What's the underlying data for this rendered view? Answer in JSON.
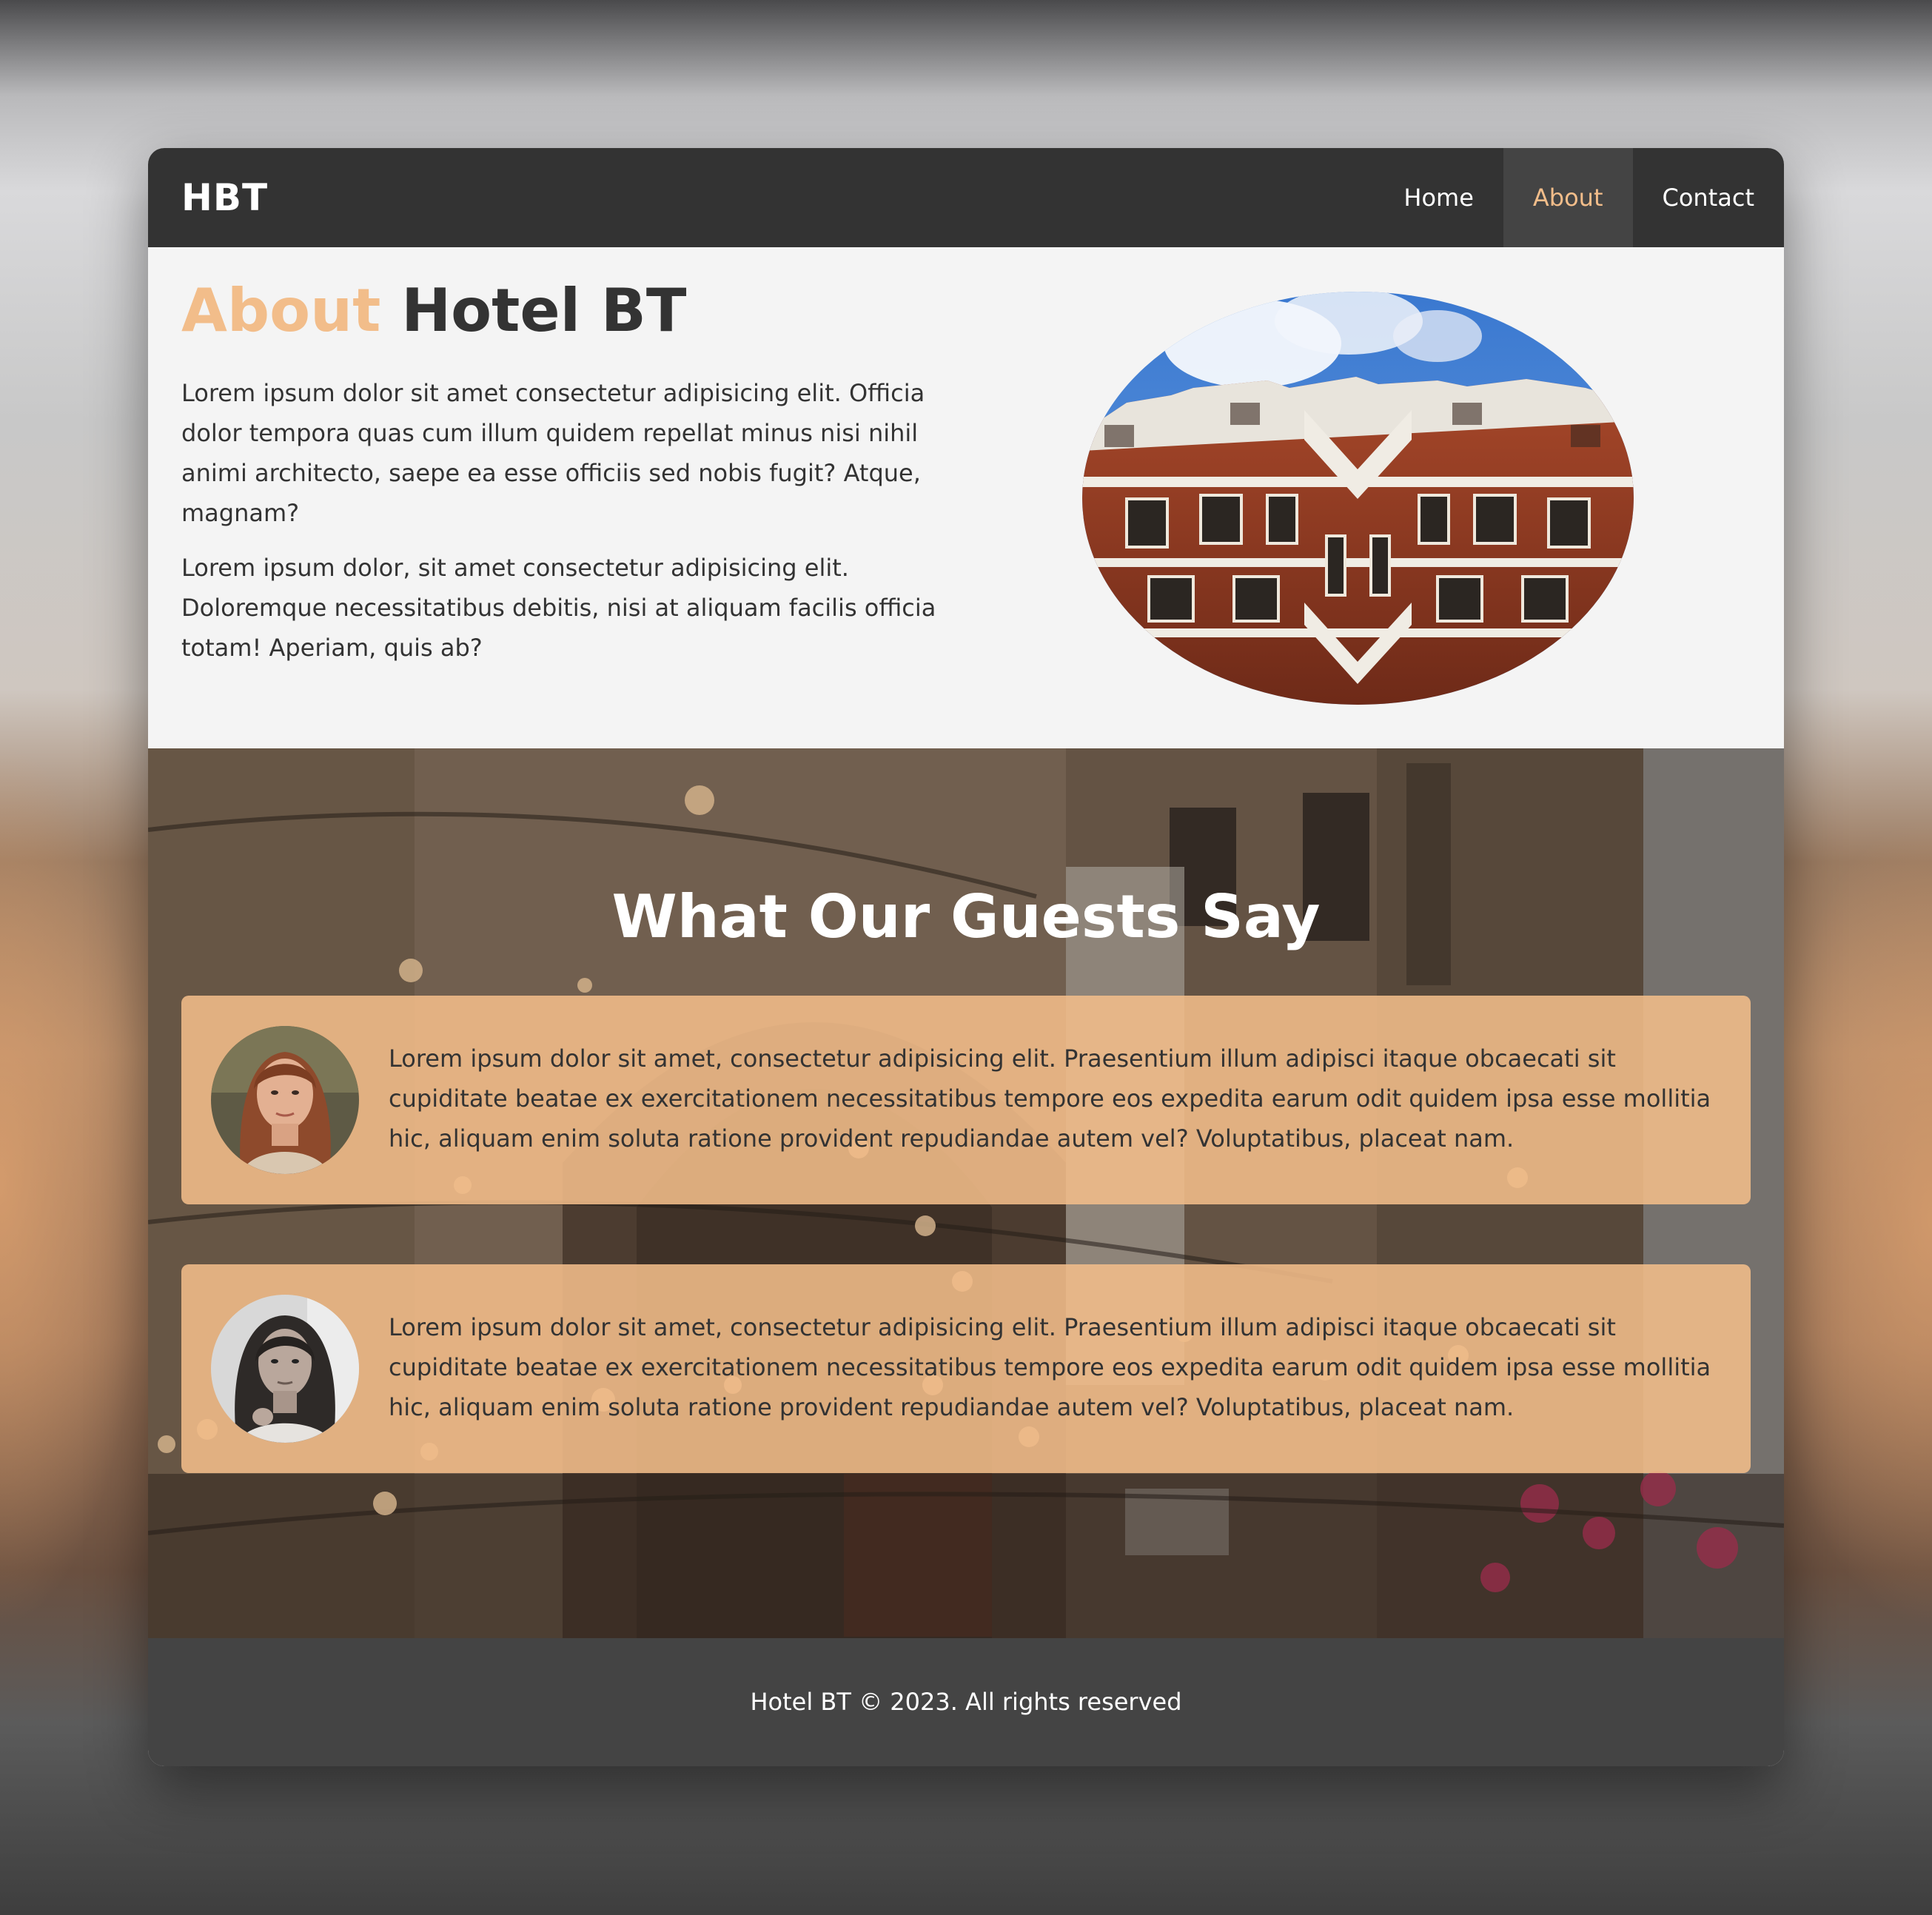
{
  "nav": {
    "logo": "HBT",
    "links": [
      {
        "label": "Home",
        "active": false
      },
      {
        "label": "About",
        "active": true
      },
      {
        "label": "Contact",
        "active": false
      }
    ]
  },
  "about": {
    "title_accent": "About",
    "title_rest": " Hotel BT",
    "paragraphs": [
      "Lorem ipsum dolor sit amet consectetur adipisicing elit. Officia dolor tempora quas cum illum quidem repellat minus nisi nihil animi architecto, saepe ea esse officiis sed nobis fugit? Atque, magnam?",
      "Lorem ipsum dolor, sit amet consectetur adipisicing elit. Doloremque necessitatibus debitis, nisi at aliquam facilis officia totam! Aperiam, quis ab?"
    ]
  },
  "testimonials": {
    "title": "What Our Guests Say",
    "items": [
      {
        "text": "Lorem ipsum dolor sit amet, consectetur adipisicing elit. Praesentium illum adipisci itaque obcaecati sit cupiditate beatae ex exercitationem necessitatibus tempore eos expedita earum odit quidem ipsa esse mollitia hic, aliquam enim soluta ratione provident repudiandae autem vel? Voluptatibus, placeat nam."
      },
      {
        "text": "Lorem ipsum dolor sit amet, consectetur adipisicing elit. Praesentium illum adipisci itaque obcaecati sit cupiditate beatae ex exercitationem necessitatibus tempore eos expedita earum odit quidem ipsa esse mollitia hic, aliquam enim soluta ratione provident repudiandae autem vel? Voluptatibus, placeat nam."
      }
    ]
  },
  "footer": {
    "text": "Hotel BT © 2023. All rights reserved"
  },
  "colors": {
    "accent": "#f2bd8a",
    "nav_bg": "#333333",
    "footer_bg": "#444444",
    "page_bg": "#f4f4f4"
  }
}
